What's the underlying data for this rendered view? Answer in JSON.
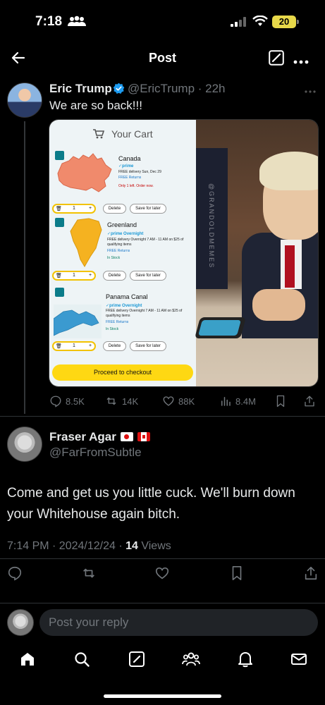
{
  "status_bar": {
    "time": "7:18",
    "battery": "20"
  },
  "header": {
    "title": "Post"
  },
  "tweet": {
    "name": "Eric Trump",
    "handle": "@EricTrump",
    "age": "22h",
    "text": "We are so back!!!",
    "media": {
      "cart_title": "Your Cart",
      "items": [
        {
          "name": "Canada",
          "prime": "✓prime",
          "delivery": "FREE delivery Sun, Dec 29",
          "returns": "FREE Returns",
          "stock": "Only 1 left. Order now.",
          "qty": "1",
          "delete": "Delete",
          "save": "Save for later"
        },
        {
          "name": "Greenland",
          "prime": "✓prime Overnight",
          "delivery": "FREE delivery Overnight 7 AM - 11 AM on $25 of qualifying items",
          "returns": "FREE Returns",
          "stock": "In Stock",
          "qty": "1",
          "delete": "Delete",
          "save": "Save for later"
        },
        {
          "name": "Panama Canal",
          "prime": "✓prime Overnight",
          "delivery": "FREE delivery Overnight 7 AM - 11 AM on $25 of qualifying items",
          "returns": "FREE Returns",
          "stock": "In Stock",
          "qty": "1",
          "delete": "Delete",
          "save": "Save for later"
        }
      ],
      "checkout": "Proceed to checkout",
      "watermark": "@GRANDOLDMEMES"
    },
    "stats": {
      "replies": "8.5K",
      "reposts": "14K",
      "likes": "88K",
      "views": "8.4M"
    }
  },
  "reply": {
    "name": "Fraser Agar",
    "handle": "@FarFromSubtle",
    "text": "Come and get us you little cuck. We'll burn down your Whitehouse again bitch.",
    "time": "7:14 PM · 2024/12/24 · ",
    "views_count": "14",
    "views_label": " Views"
  },
  "composer": {
    "placeholder": "Post your reply"
  },
  "colors": {
    "accent": "#1d9bf0",
    "background": "#000000",
    "muted": "#71767b",
    "checkout": "#fed813"
  }
}
